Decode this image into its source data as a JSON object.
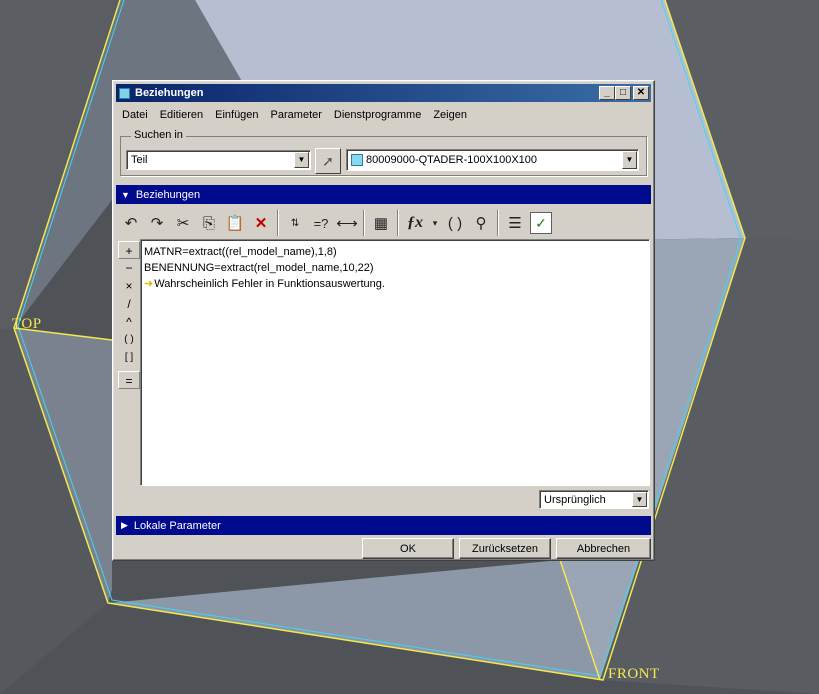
{
  "viewport": {
    "labels": {
      "top": "TOP",
      "front": "FRONT"
    }
  },
  "window": {
    "title": "Beziehungen",
    "controls": {
      "minimize": "_",
      "maximize": "□",
      "close": "✕"
    }
  },
  "menu": [
    "Datei",
    "Editieren",
    "Einfügen",
    "Parameter",
    "Dienstprogramme",
    "Zeigen"
  ],
  "search": {
    "legend": "Suchen in",
    "scope_value": "Teil",
    "model_value": "80009000-QTADER-100X100X100"
  },
  "sections": {
    "relations": "Beziehungen",
    "local_params": "Lokale Parameter"
  },
  "toolbar_icons": [
    "undo-icon",
    "redo-icon",
    "cut-icon",
    "copy-icon",
    "paste-icon",
    "delete-icon",
    "display-units-icon",
    "evaluate-icon",
    "dimension-icon",
    "sort-icon",
    "function-icon",
    "parentheses-icon",
    "verify-icon",
    "show-list-icon",
    "check-relations-icon"
  ],
  "operators": [
    "+",
    "−",
    "×",
    "/",
    "^",
    "( )",
    "[ ]",
    "="
  ],
  "editor": {
    "lines": [
      "MATNR=extract((rel_model_name),1,8)",
      "BENENNUNG=extract(rel_model_name,10,22)"
    ],
    "warning": "Wahrscheinlich Fehler in Funktionsauswertung."
  },
  "units_select": {
    "value": "Ursprünglich"
  },
  "buttons": {
    "ok": "OK",
    "reset": "Zurücksetzen",
    "cancel": "Abbrechen"
  },
  "colors": {
    "section_bar": "#000a8c",
    "title_start": "#0a246a",
    "edge_yellow": "#f2e850",
    "edge_cyan": "#3fd6f0"
  }
}
